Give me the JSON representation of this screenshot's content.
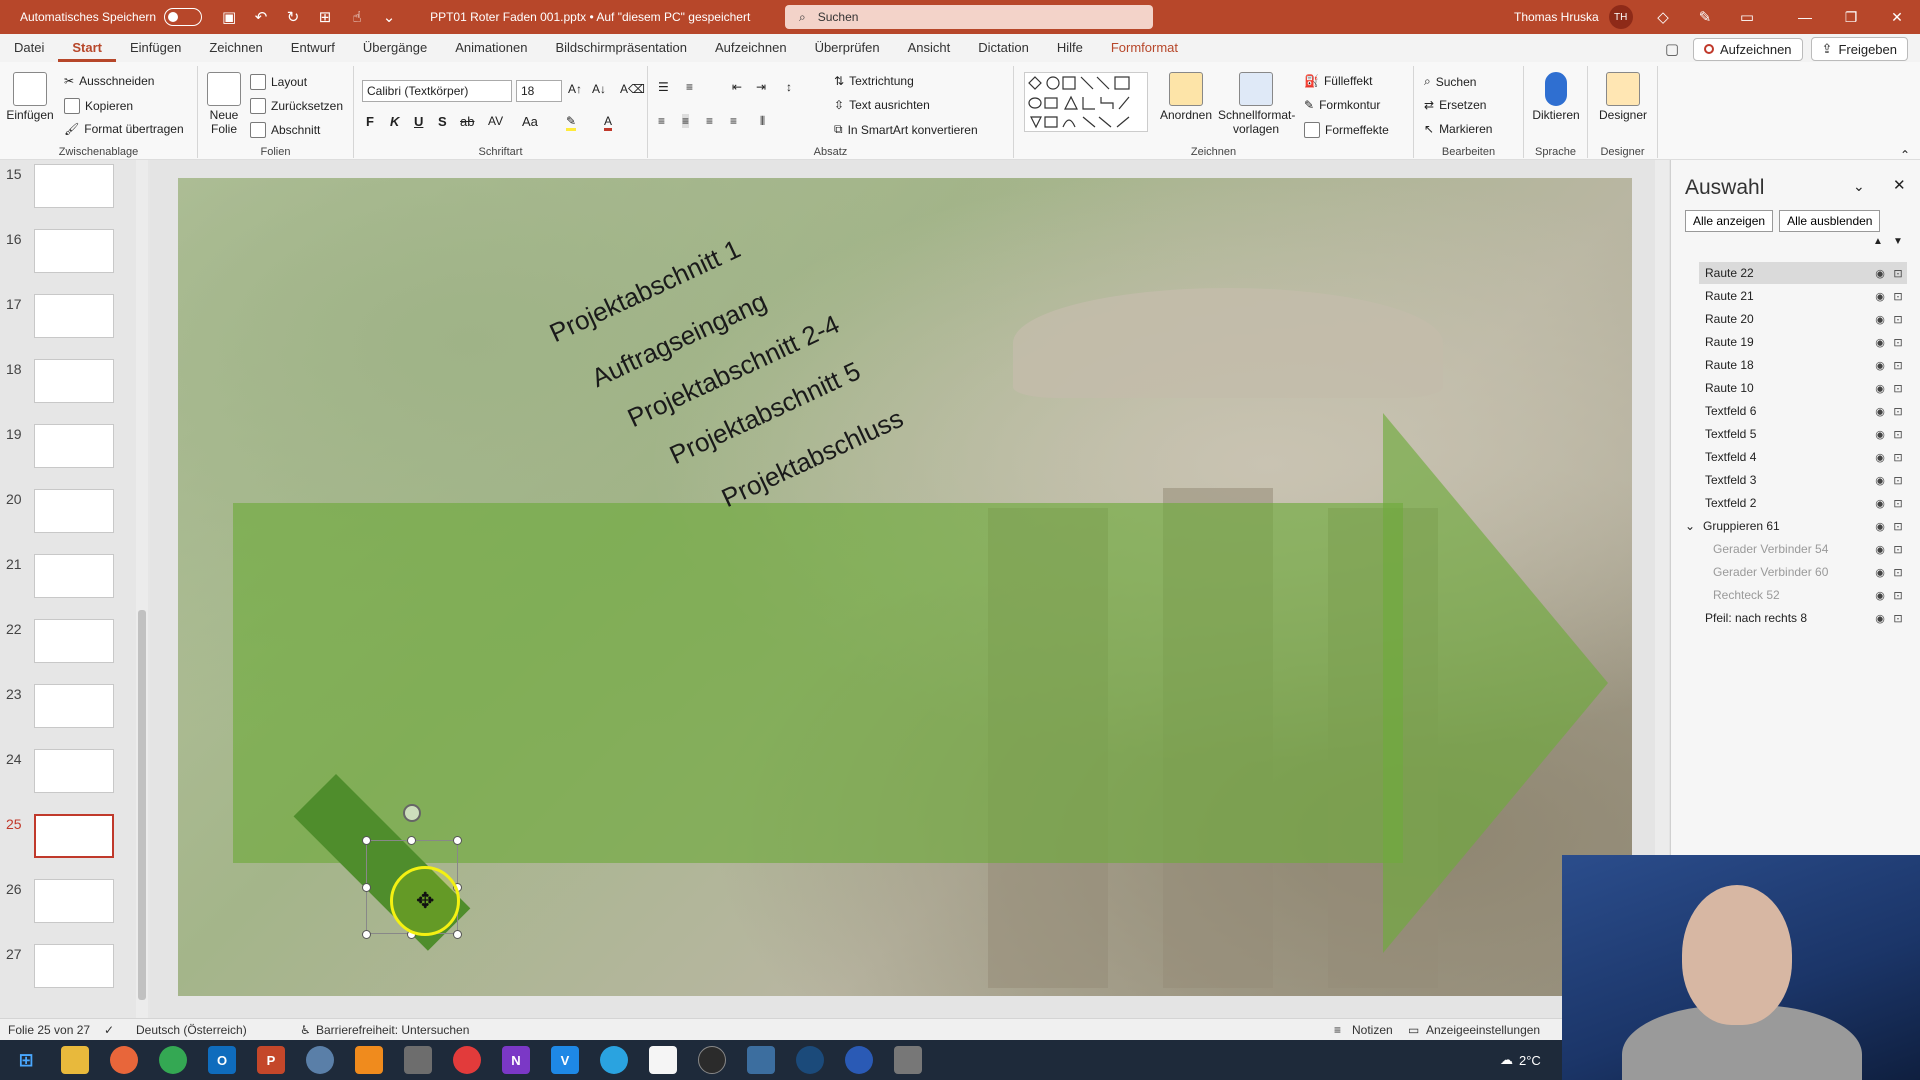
{
  "titlebar": {
    "autosave_label": "Automatisches Speichern",
    "doc_title": "PPT01 Roter Faden 001.pptx  •  Auf \"diesem PC\" gespeichert",
    "search_placeholder": "Suchen",
    "user_name": "Thomas Hruska",
    "user_initials": "TH"
  },
  "menu": {
    "tabs": [
      "Datei",
      "Start",
      "Einfügen",
      "Zeichnen",
      "Entwurf",
      "Übergänge",
      "Animationen",
      "Bildschirmpräsentation",
      "Aufzeichnen",
      "Überprüfen",
      "Ansicht",
      "Dictation",
      "Hilfe",
      "Formformat"
    ],
    "record_label": "Aufzeichnen",
    "share_label": "Freigeben"
  },
  "ribbon": {
    "clipboard": {
      "paste": "Einfügen",
      "cut": "Ausschneiden",
      "copy": "Kopieren",
      "format_painter": "Format übertragen",
      "label": "Zwischenablage"
    },
    "slides": {
      "new_slide": "Neue Folie",
      "layout": "Layout",
      "reset": "Zurücksetzen",
      "section": "Abschnitt",
      "label": "Folien"
    },
    "font": {
      "family": "Calibri (Textkörper)",
      "size": "18",
      "label": "Schriftart",
      "bold": "F",
      "italic": "K",
      "underline": "U",
      "shadow": "S",
      "strike": "ab",
      "case": "Aa"
    },
    "paragraph": {
      "text_direction": "Textrichtung",
      "align_text": "Text ausrichten",
      "smartart": "In SmartArt konvertieren",
      "label": "Absatz"
    },
    "drawing": {
      "arrange": "Anordnen",
      "quick_styles": "Schnellformat-vorlagen",
      "fill": "Fülleffekt",
      "outline": "Formkontur",
      "effects": "Formeffekte",
      "label": "Zeichnen"
    },
    "editing": {
      "find": "Suchen",
      "replace": "Ersetzen",
      "select": "Markieren",
      "label": "Bearbeiten"
    },
    "voice": {
      "dictate": "Diktieren",
      "label": "Sprache"
    },
    "designer": {
      "designer": "Designer",
      "label": "Designer"
    }
  },
  "thumbnails": [
    {
      "num": "15"
    },
    {
      "num": "16"
    },
    {
      "num": "17"
    },
    {
      "num": "18"
    },
    {
      "num": "19"
    },
    {
      "num": "20"
    },
    {
      "num": "21"
    },
    {
      "num": "22"
    },
    {
      "num": "23"
    },
    {
      "num": "24"
    },
    {
      "num": "25"
    },
    {
      "num": "26"
    },
    {
      "num": "27"
    }
  ],
  "active_slide": "25",
  "slide": {
    "labels": [
      "Projektabschnitt 1",
      "Auftragseingang",
      "Projektabschnitt 2-4",
      "Projektabschnitt 5",
      "Projektabschluss"
    ]
  },
  "selection_pane": {
    "title": "Auswahl",
    "show_all": "Alle anzeigen",
    "hide_all": "Alle ausblenden",
    "items": [
      {
        "name": "Raute 22",
        "selected": true
      },
      {
        "name": "Raute 21"
      },
      {
        "name": "Raute 20"
      },
      {
        "name": "Raute 19"
      },
      {
        "name": "Raute 18"
      },
      {
        "name": "Raute 10"
      },
      {
        "name": "Textfeld 6"
      },
      {
        "name": "Textfeld 5"
      },
      {
        "name": "Textfeld 4"
      },
      {
        "name": "Textfeld 3"
      },
      {
        "name": "Textfeld 2"
      },
      {
        "name": "Gruppieren 61",
        "group": true
      },
      {
        "name": "Gerader Verbinder 54",
        "child": true
      },
      {
        "name": "Gerader Verbinder 60",
        "child": true
      },
      {
        "name": "Rechteck 52",
        "child": true
      },
      {
        "name": "Pfeil: nach rechts 8"
      }
    ]
  },
  "status": {
    "slide_info": "Folie 25 von 27",
    "language": "Deutsch (Österreich)",
    "accessibility": "Barrierefreiheit: Untersuchen",
    "notes": "Notizen",
    "display": "Anzeigeeinstellungen"
  },
  "taskbar": {
    "temperature": "2°C"
  },
  "colors": {
    "accent": "#b7472a",
    "arrow": "#6eaa3c",
    "diamond": "#4f8d2c"
  }
}
